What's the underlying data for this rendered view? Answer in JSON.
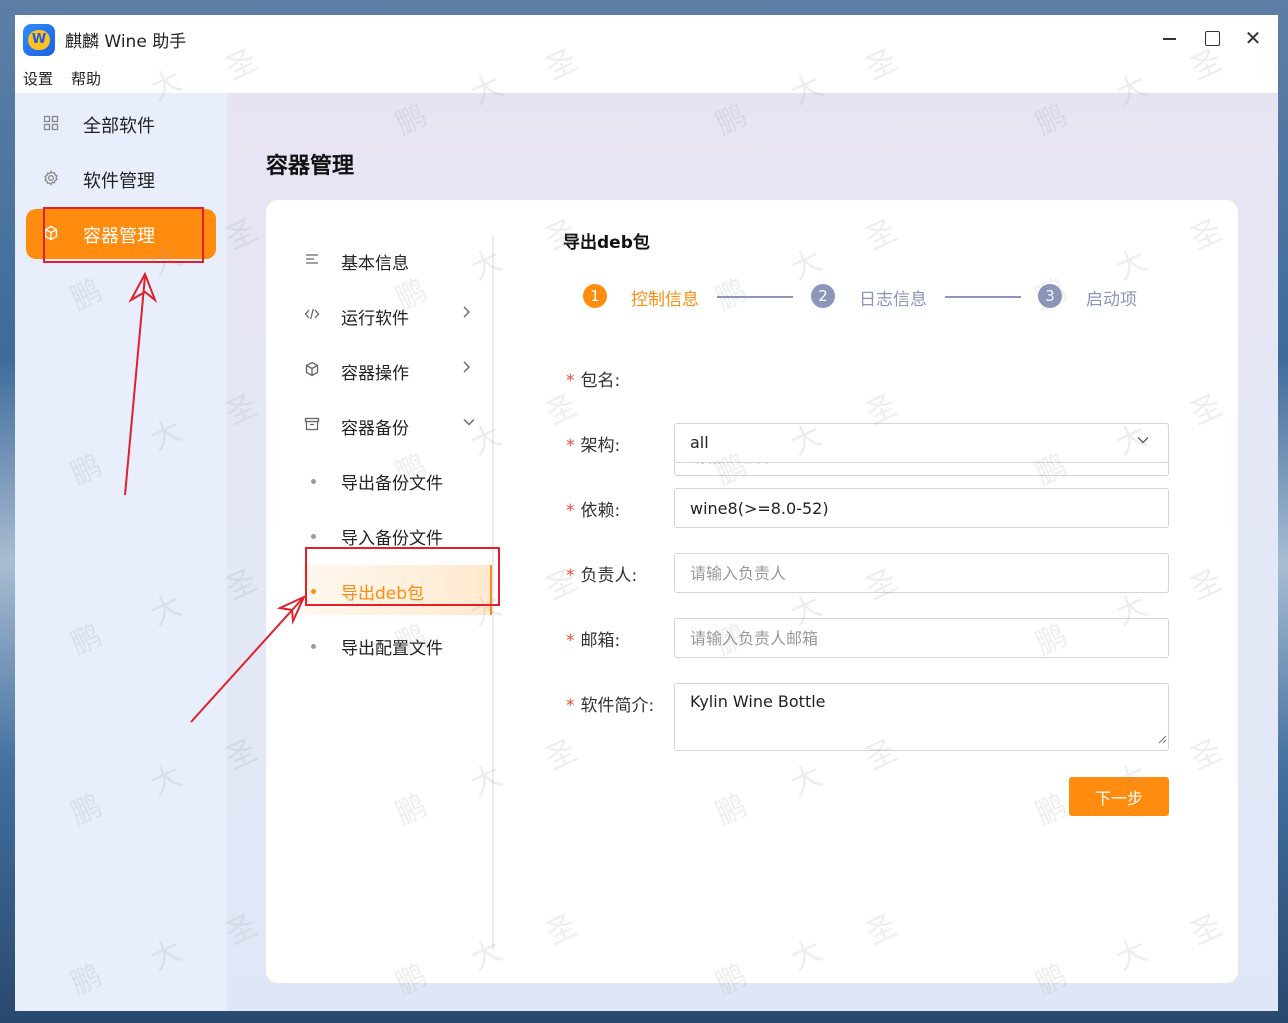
{
  "window": {
    "title": "麒麟 Wine 助手",
    "logo_letter": "W",
    "minimize_icon": "minimize-icon",
    "maximize_icon": "maximize-icon",
    "close_icon": "close-icon"
  },
  "menubar": [
    "设置",
    "帮助"
  ],
  "sidebar": {
    "items": [
      {
        "label": "全部软件",
        "icon": "grid-icon"
      },
      {
        "label": "软件管理",
        "icon": "gear-icon"
      },
      {
        "label": "容器管理",
        "icon": "cube-icon",
        "active": true
      }
    ]
  },
  "page": {
    "title": "容器管理"
  },
  "subnav": {
    "items": [
      {
        "label": "基本信息",
        "icon": "list-icon"
      },
      {
        "label": "运行软件",
        "icon": "code-icon",
        "expandable": true
      },
      {
        "label": "容器操作",
        "icon": "cube-icon",
        "expandable": true
      },
      {
        "label": "容器备份",
        "icon": "archive-icon",
        "expanded": true
      },
      {
        "label": "导出备份文件",
        "child": true
      },
      {
        "label": "导入备份文件",
        "child": true
      },
      {
        "label": "导出deb包",
        "child": true,
        "active": true
      },
      {
        "label": "导出配置文件",
        "child": true
      }
    ]
  },
  "section": {
    "title": "导出deb包"
  },
  "steps": [
    {
      "num": "1",
      "label": "控制信息",
      "active": true
    },
    {
      "num": "2",
      "label": "日志信息"
    },
    {
      "num": "3",
      "label": "启动项"
    }
  ],
  "form": {
    "package_name": {
      "label": "包名:",
      "value": "",
      "placeholder": "请输入包名"
    },
    "arch": {
      "label": "架构:",
      "value": "all"
    },
    "depends": {
      "label": "依赖:",
      "value": "wine8(>=8.0-52)"
    },
    "maintainer": {
      "label": "负责人:",
      "value": "",
      "placeholder": "请输入负责人"
    },
    "email": {
      "label": "邮箱:",
      "value": "",
      "placeholder": "请输入负责人邮箱"
    },
    "description": {
      "label": "软件简介:",
      "value": "Kylin Wine Bottle"
    },
    "required_mark": "*"
  },
  "buttons": {
    "next": "下一步"
  },
  "watermark": [
    "鹏",
    "大",
    "圣"
  ]
}
